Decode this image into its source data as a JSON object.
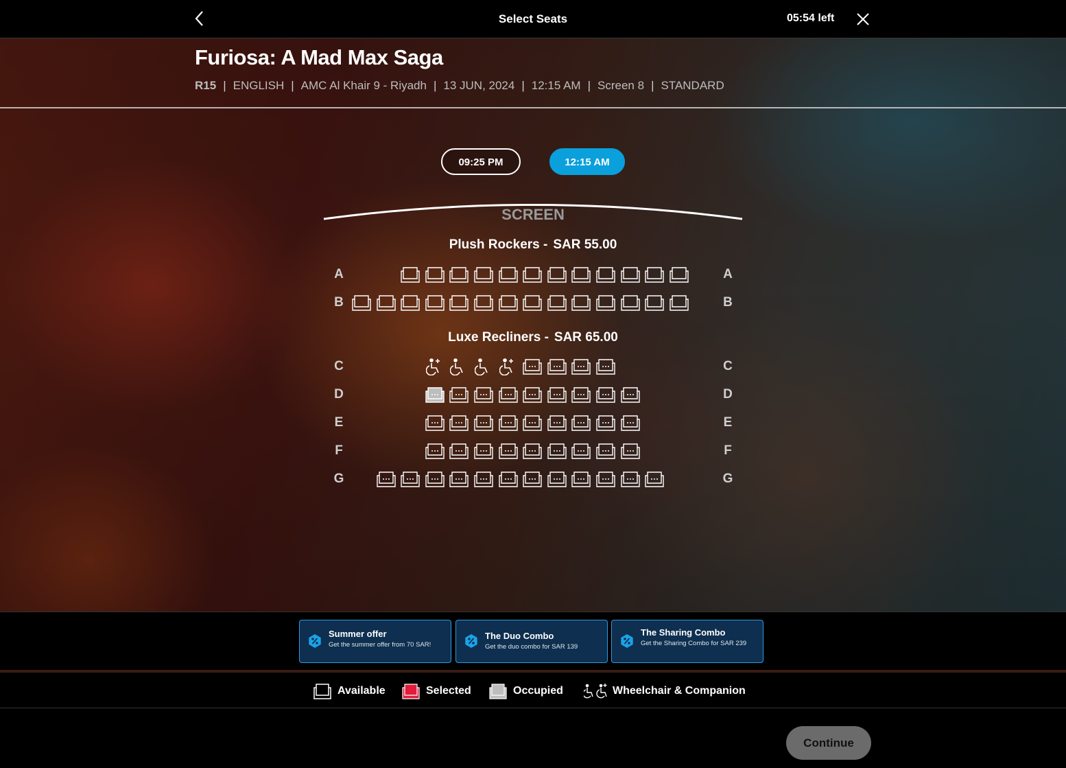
{
  "header": {
    "title": "Select Seats",
    "timer": "05:54 left"
  },
  "movie": {
    "title": "Furiosa: A Mad Max Saga",
    "rating": "R15",
    "language": "ENGLISH",
    "cinema": "AMC Al Khair 9 - Riyadh",
    "date": "13 JUN, 2024",
    "time": "12:15 AM",
    "screen": "Screen 8",
    "format": "STANDARD"
  },
  "showtimes": [
    {
      "label": "09:25 PM",
      "selected": false
    },
    {
      "label": "12:15 AM",
      "selected": true
    }
  ],
  "screen_label": "SCREEN",
  "sections": [
    {
      "name": "Plush Rockers -",
      "price": "SAR  55.00",
      "rows": [
        {
          "label": "A",
          "seats": [
            "",
            "",
            "a",
            "a",
            "a",
            "a",
            "a",
            "a",
            "a",
            "a",
            "a",
            "a",
            "a",
            "a"
          ]
        },
        {
          "label": "B",
          "seats": [
            "a",
            "a",
            "a",
            "a",
            "a",
            "a",
            "a",
            "a",
            "a",
            "a",
            "a",
            "a",
            "a",
            "a"
          ]
        }
      ]
    },
    {
      "name": "Luxe Recliners -",
      "price": "SAR  65.00",
      "rows": [
        {
          "label": "C",
          "seats": [
            "",
            "",
            "",
            "c",
            "w",
            "w",
            "c",
            "r",
            "r",
            "r",
            "r",
            "",
            "",
            ""
          ]
        },
        {
          "label": "D",
          "seats": [
            "",
            "",
            "",
            "o",
            "r",
            "r",
            "r",
            "r",
            "r",
            "r",
            "r",
            "r",
            "",
            ""
          ]
        },
        {
          "label": "E",
          "seats": [
            "",
            "",
            "",
            "r",
            "r",
            "r",
            "r",
            "r",
            "r",
            "r",
            "r",
            "r",
            "",
            ""
          ]
        },
        {
          "label": "F",
          "seats": [
            "",
            "",
            "",
            "r",
            "r",
            "r",
            "r",
            "r",
            "r",
            "r",
            "r",
            "r",
            "",
            ""
          ]
        },
        {
          "label": "G",
          "seats": [
            "",
            "r",
            "r",
            "r",
            "r",
            "r",
            "r",
            "r",
            "r",
            "r",
            "r",
            "r",
            "r",
            ""
          ]
        }
      ]
    }
  ],
  "offers": [
    {
      "title": "Summer offer",
      "description": "Get the summer offer from 70 SAR!"
    },
    {
      "title": "The Duo Combo",
      "description": "Get the duo combo for SAR 139"
    },
    {
      "title": "The Sharing Combo",
      "description": "Get the Sharing Combo for SAR 239"
    }
  ],
  "legend": {
    "available": "Available",
    "selected": "Selected",
    "occupied": "Occupied",
    "wheelchair": "Wheelchair & Companion"
  },
  "colors": {
    "accent": "#0aa0dc",
    "selected": "#e31b3c",
    "occupied": "#bdbdbd",
    "offer_border": "#2a9be0"
  },
  "continue_label": "Continue"
}
